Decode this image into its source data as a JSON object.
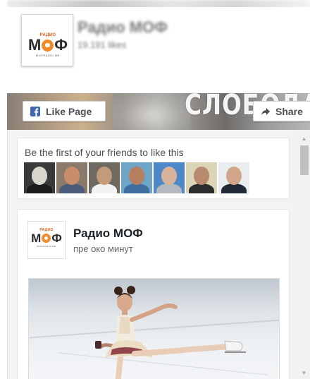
{
  "page": {
    "name": "Радио МОФ",
    "likes": "19.191 likes",
    "cover_text": "СЛОБОДА",
    "logo": {
      "top_text": "РАДИО",
      "main_text": "МОФ",
      "bottom_text": "MOFRADIO.ME"
    }
  },
  "buttons": {
    "like_label": "Like Page",
    "like_icon": "facebook-f-icon",
    "share_label": "Share",
    "share_icon": "share-icon"
  },
  "friends": {
    "text": "Be the first of your friends to like this",
    "faces": [
      {
        "name": "friend-1",
        "bg": "#3a3a3a",
        "skin": "#d9d6cf",
        "shirt": "#1c1c1c"
      },
      {
        "name": "friend-2",
        "bg": "#8a7a6c",
        "skin": "#c98d6b",
        "shirt": "#4a5c7a"
      },
      {
        "name": "friend-3",
        "bg": "#6f6a61",
        "skin": "#c39a7a",
        "shirt": "#f2f2f2"
      },
      {
        "name": "friend-4",
        "bg": "#6fa6c7",
        "skin": "#b57f60",
        "shirt": "#3e6fa0"
      },
      {
        "name": "friend-5",
        "bg": "#4f88c9",
        "skin": "#d9b29a",
        "shirt": "#b3b9bf"
      },
      {
        "name": "friend-6",
        "bg": "#dbd4b5",
        "skin": "#b98a6f",
        "shirt": "#2c2c2c"
      },
      {
        "name": "friend-7",
        "bg": "#e9edf0",
        "skin": "#d0a58a",
        "shirt": "#1f2a36"
      }
    ]
  },
  "post": {
    "author": "Радио МОФ",
    "time": "пре око минут",
    "image": "figure-skater-photo"
  },
  "colors": {
    "logo_accent": "#f08c2b",
    "stream_bg": "#f2f3f5"
  }
}
